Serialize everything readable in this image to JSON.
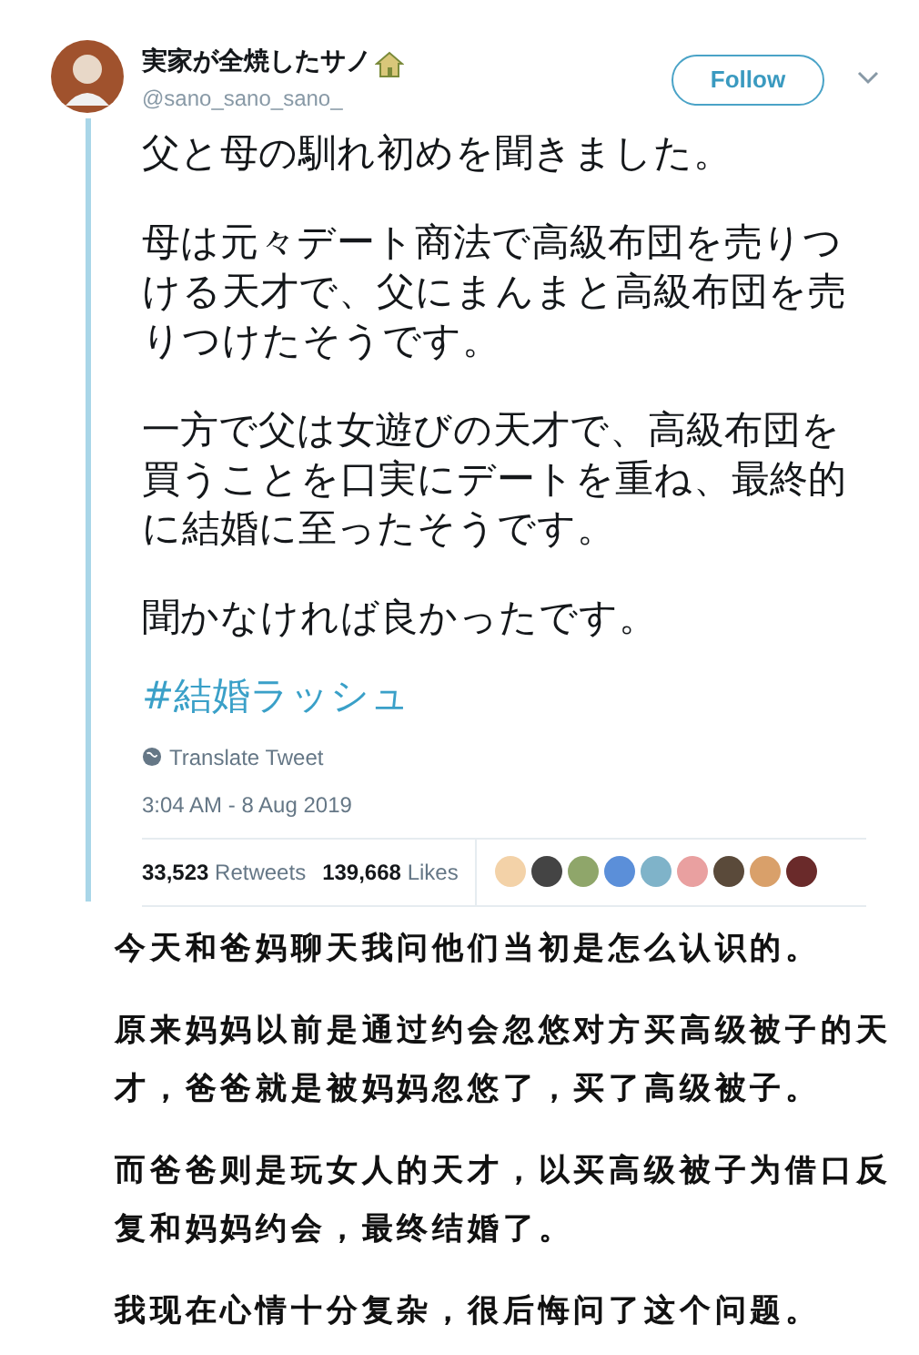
{
  "tweet": {
    "author": {
      "name": "実家が全焼したサノ",
      "handle": "@sano_sano_sano_"
    },
    "follow_button": "Follow",
    "paragraphs": [
      "父と母の馴れ初めを聞きました。",
      "母は元々デート商法で高級布団を売りつける天才で、父にまんまと高級布団を売りつけたそうです。",
      "一方で父は女遊びの天才で、高級布団を買うことを口実にデートを重ね、最終的に結婚に至ったそうです。",
      "聞かなければ良かったです。"
    ],
    "hashtag": "#結婚ラッシュ",
    "translate": "Translate Tweet",
    "timestamp": "3:04 AM - 8 Aug 2019",
    "stats": [
      {
        "count": "33,523",
        "label": "Retweets"
      },
      {
        "count": "139,668",
        "label": "Likes"
      }
    ]
  },
  "translation": {
    "paragraphs": [
      "今天和爸妈聊天我问他们当初是怎么认识的。",
      "原来妈妈以前是通过约会忽悠对方买高级被子的天才，爸爸就是被妈妈忽悠了，买了高级被子。",
      "而爸爸则是玩女人的天才，以买高级被子为借口反复和妈妈约会，最终结婚了。",
      "我现在心情十分复杂，很后悔问了这个问题。"
    ]
  }
}
